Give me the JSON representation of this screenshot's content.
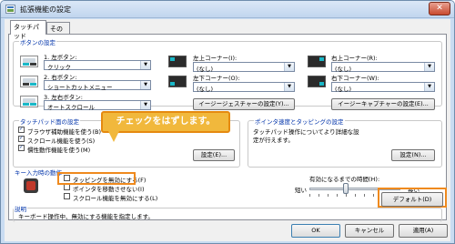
{
  "window": {
    "title": "拡張機能の設定",
    "close_glyph": "✕"
  },
  "tabs": [
    {
      "label": "タッチパッド"
    },
    {
      "label": "その他"
    }
  ],
  "button_settings": {
    "group_label": "ボタンの設定",
    "rows": [
      {
        "label": "1. 左ボタン:",
        "value": "クリック"
      },
      {
        "label": "2. 右ボタン:",
        "value": "ショートカットメニュー"
      },
      {
        "label": "3. 左右ボタン:",
        "value": "オートスクロール"
      }
    ],
    "corners": [
      {
        "label": "左上コーナー(I):",
        "value": "(なし)"
      },
      {
        "label": "右上コーナー(R):",
        "value": "(なし)"
      },
      {
        "label": "左下コーナー(O):",
        "value": "(なし)"
      },
      {
        "label": "右下コーナー(W):",
        "value": "(なし)"
      }
    ],
    "gesture_button": "イージージェスチャーの設定(Y)...",
    "capture_button": "イージーキャプチャーの設定(E)..."
  },
  "touchpad_surface": {
    "group_label": "タッチパッド面の設定",
    "checkboxes": [
      {
        "label": "ブラウザ補助機能を使う(B)",
        "checked": true
      },
      {
        "label": "スクロール機能を使う(S)",
        "checked": true
      },
      {
        "label": "慣性動作機能を使う(M)",
        "checked": true
      }
    ],
    "settings_button": "設定(E)..."
  },
  "pointer_speed": {
    "group_label": "ポインタ速度とタッピングの設定",
    "description": "タッチパッド操作についてより詳細な設定が行えます。",
    "settings_button": "設定(N)..."
  },
  "keyboard_input": {
    "group_label": "キー入力時の動作",
    "checkboxes": [
      {
        "label": "タッピングを無効にする(F)",
        "checked": false
      },
      {
        "label": "ポインタを移動させない(I)",
        "checked": false
      },
      {
        "label": "スクロール機能を無効にする(L)",
        "checked": false
      }
    ],
    "timer_label": "有効になるまでの時間(H):",
    "short_label": "短い",
    "long_label": "長い",
    "slider_value_fraction": 0.4
  },
  "description": {
    "group_label": "説明",
    "text": "キーボード操作中、無効にする機能を指定します。",
    "default_button": "デフォルト(D)"
  },
  "callout": {
    "text": "チェックをはずします。"
  },
  "dialog_buttons": {
    "ok": "OK",
    "cancel": "キャンセル",
    "apply": "適用(A)"
  },
  "colors": {
    "accent_orange": "#ef8a1e",
    "callout_fill": "#f1b83c",
    "active_button_cyan": "#19b8c8"
  }
}
